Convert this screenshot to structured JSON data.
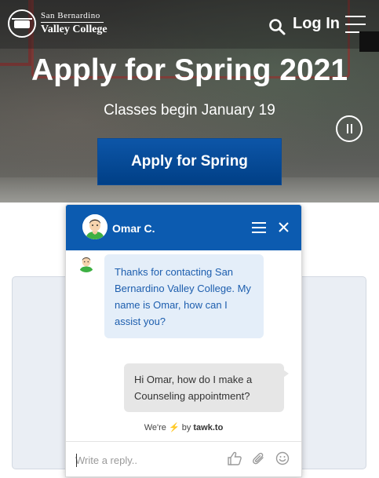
{
  "header": {
    "logo_line1": "San Bernardino",
    "logo_line2": "Valley College",
    "login_label": "Log In",
    "icons": {
      "search": "search-icon",
      "menu": "hamburger-menu-icon",
      "logo": "college-logo-icon"
    }
  },
  "hero": {
    "title": "Apply for Spring 2021",
    "subtitle": "Classes begin January 19",
    "cta_label": "Apply for Spring",
    "pause_icon": "pause-icon",
    "colors": {
      "cta": "#0d56a8"
    }
  },
  "chat": {
    "agent_name": "Omar C.",
    "colors": {
      "header": "#0c5bb0",
      "incoming_bubble": "#e4eef9",
      "outgoing_bubble": "#e6e6e6"
    },
    "icons": {
      "menu": "chat-menu-icon",
      "close": "close-icon",
      "like": "thumbs-up-icon",
      "attach": "paperclip-icon",
      "emoji": "smiley-icon"
    },
    "messages": [
      {
        "from": "agent",
        "text": "Thanks for contacting San Bernardino Valley College. My name is Omar, how can I assist you?"
      },
      {
        "from": "visitor",
        "text": "Hi Omar, how do I make a Counseling appointment?"
      }
    ],
    "powered_prefix": "We're",
    "powered_by": "by",
    "powered_brand": "tawk.to",
    "reply_placeholder": "Write a reply.."
  }
}
